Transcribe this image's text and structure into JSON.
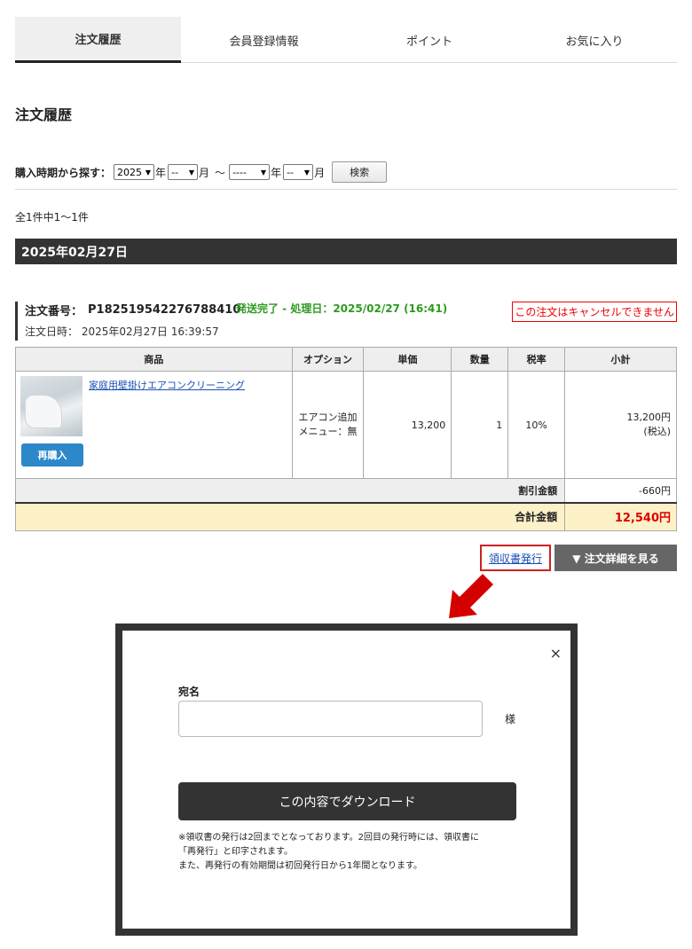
{
  "tabs": [
    "注文履歴",
    "会員登録情報",
    "ポイント",
    "お気に入り"
  ],
  "page_title": "注文履歴",
  "filter": {
    "label": "購入時期から探す：",
    "year_from": "2025",
    "month_from": "--",
    "year_to": "----",
    "month_to": "--",
    "year_unit": "年",
    "month_unit": "月",
    "tilde": "～",
    "search_label": "検索"
  },
  "result_count": "全1件中1～1件",
  "date_header": "2025年02月27日",
  "order": {
    "number_label": "注文番号：",
    "number": "P182519542276788410",
    "status": "発送完了 - 処理日：2025/02/27 (16:41)",
    "cancel_note": "この注文はキャンセルできません",
    "date_label": "注文日時：",
    "date": "2025年02月27日 16:39:57"
  },
  "table": {
    "headers": [
      "商品",
      "オプション",
      "単価",
      "数量",
      "税率",
      "小計"
    ],
    "row": {
      "product": "家庭用壁掛けエアコンクリーニング",
      "rebuy": "再購入",
      "option_line1": "エアコン追加",
      "option_line2": "メニュー：無",
      "unit_price": "13,200",
      "qty": "1",
      "tax": "10%",
      "subtotal": "13,200円",
      "subtotal_note": "(税込)"
    },
    "discount_label": "割引金額",
    "discount_value": "-660円",
    "total_label": "合計金額",
    "total_value": "12,540円"
  },
  "receipt_link": "領収書発行",
  "detail_button": "▼ 注文詳細を見る",
  "modal": {
    "close": "×",
    "name_label": "宛名",
    "suffix": "様",
    "download": "この内容でダウンロード",
    "note_line1": "※領収書の発行は2回までとなっております。2回目の発行時には、領収書に",
    "note_line2": "「再発行」と印字されます。",
    "note_line3": "また、再発行の有効期間は初回発行日から1年間となります。"
  },
  "colors": {
    "accent_red": "#dd0000",
    "status_green": "#2e9a1f",
    "total_bg": "#fdf1c8",
    "rebuy_blue": "#2c88c9"
  }
}
